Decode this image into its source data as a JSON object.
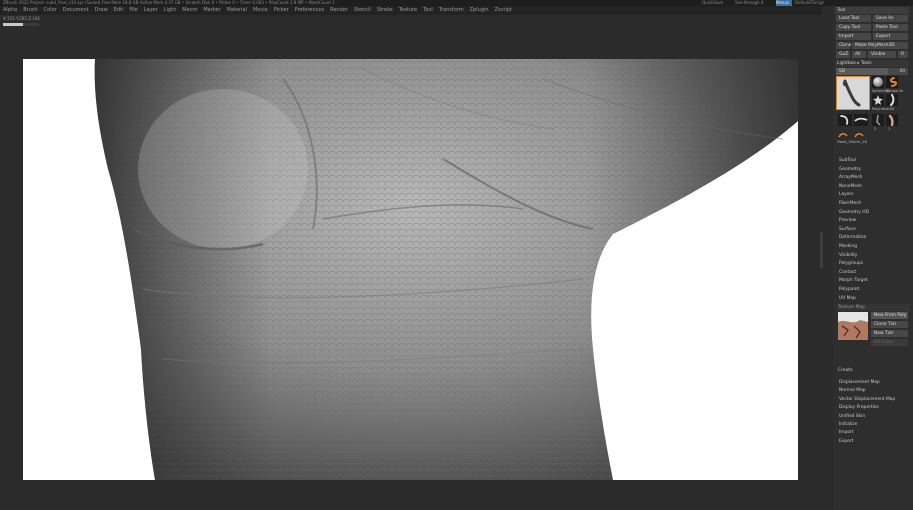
{
  "window": {
    "title": "ZBrush 2022 Project: subd_final_v14.zpr (Saved) Free Mem 18.6 GB Active Mem 4.37 GB • Scratch Disk 0 • Rtime 0 • Timer 0.003 • PolyCount 2.8 MP • MeshCount 1",
    "right_items": [
      "QuickSave",
      "See-through 0",
      "Menus",
      "DefaultZScript"
    ]
  },
  "menubar": {
    "items": [
      "Alpha",
      "Brush",
      "Color",
      "Document",
      "Draw",
      "Edit",
      "File",
      "Layer",
      "Light",
      "Macro",
      "Marker",
      "Material",
      "Movie",
      "Picker",
      "Preferences",
      "Render",
      "Stencil",
      "Stroke",
      "Texture",
      "Tool",
      "Transform",
      "Zplugin",
      "Zscript"
    ]
  },
  "status": {
    "readout": "X:153 Y:205 Z:160",
    "progress": 0.55
  },
  "tool_panel": {
    "title": "Tool",
    "load_tool": "Load Tool",
    "save_as": "Save As",
    "copy_tool": "Copy Tool",
    "paste_tool": "Paste Tool",
    "import": "Import",
    "export": "Export",
    "clone": "Clone",
    "make_polymesh": "Make PolyMesh3D",
    "goz": "GoZ",
    "all": "All",
    "visible": "Visible",
    "r": "R",
    "lightbox": "Lightbox ▸ Tools",
    "slider_label": "SD",
    "slider_value": "44",
    "slider_fill": 0.72,
    "thumbs": [
      "arm_mesh",
      "Sphere3D",
      "SimpleBrush",
      "Polymesh3D",
      "Star",
      "Arm",
      "Arm2",
      "Flat",
      "Leg",
      "Hand"
    ],
    "thumb_labels": [
      "Sphere3D",
      "Simple Br",
      "Polymesh3D",
      "2",
      "1"
    ],
    "plugin_labels": [
      "Hand_18",
      "Arm_18"
    ],
    "subtools": [
      "SubTool",
      "Geometry",
      "ArrayMesh",
      "NanoMesh",
      "Layers",
      "FiberMesh",
      "Geometry HD",
      "Preview",
      "Surface",
      "Deformation",
      "Masking",
      "Visibility",
      "Polygroups",
      "Contact",
      "Morph Target",
      "Polypaint",
      "UV Map"
    ],
    "texture_map": {
      "header": "Texture Map",
      "new_from": "New From Poly",
      "clone_txtr": "Clone Txtr",
      "new_txtr": "New Txtr",
      "fill": "Fill Color",
      "create": "Create"
    },
    "more_items": [
      "Displacement Map",
      "Normal Map",
      "Vector Displacement Map",
      "Display Properties",
      "Unified Skin",
      "Initialize",
      "Import",
      "Export"
    ]
  },
  "colors": {
    "background": "#2b2b2b",
    "canvas": "#ffffff",
    "accent": "#e08a2a",
    "selected": "#3d6fa8"
  }
}
